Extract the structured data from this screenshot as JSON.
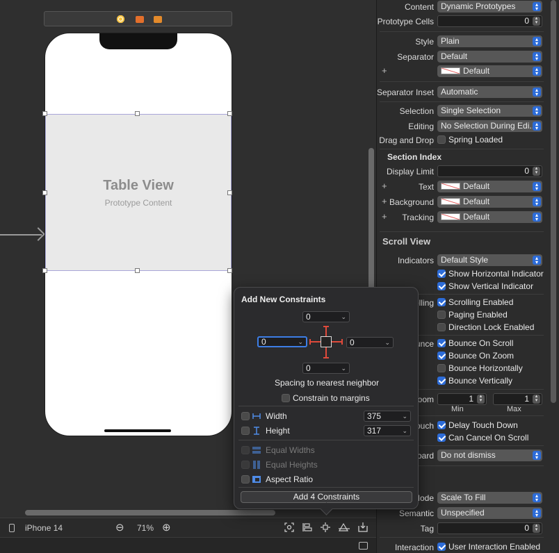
{
  "canvas": {
    "table_view_title": "Table View",
    "table_view_subtitle": "Prototype Content"
  },
  "bottombar": {
    "device": "iPhone 14",
    "zoom_out_glyph": "⊖",
    "zoom_level": "71%",
    "zoom_in_glyph": "⊕"
  },
  "inspector": {
    "content": {
      "label": "Content",
      "value": "Dynamic Prototypes"
    },
    "prototype_cells": {
      "label": "Prototype Cells",
      "value": "0"
    },
    "style": {
      "label": "Style",
      "value": "Plain"
    },
    "separator": {
      "label": "Separator",
      "value": "Default"
    },
    "separator_color": {
      "value": "Default"
    },
    "separator_inset": {
      "label": "Separator Inset",
      "value": "Automatic"
    },
    "selection": {
      "label": "Selection",
      "value": "Single Selection"
    },
    "editing": {
      "label": "Editing",
      "value": "No Selection During Edi..."
    },
    "drag_drop": {
      "label": "Drag and Drop",
      "checkbox": "Spring Loaded",
      "checked": false
    },
    "section_index": {
      "title": "Section Index",
      "display_limit": {
        "label": "Display Limit",
        "value": "0"
      },
      "text": {
        "label": "Text",
        "value": "Default"
      },
      "background": {
        "label": "Background",
        "value": "Default"
      },
      "tracking": {
        "label": "Tracking",
        "value": "Default"
      }
    },
    "scroll_view": {
      "title": "Scroll View",
      "indicators": {
        "label": "Indicators",
        "value": "Default Style"
      },
      "show_h": "Show Horizontal Indicator",
      "show_v": "Show Vertical Indicator",
      "scrolling_label": "Scrolling",
      "scrolling_enabled": "Scrolling Enabled",
      "paging_enabled": "Paging Enabled",
      "direction_lock": "Direction Lock Enabled",
      "bounce_label": "Bounce",
      "bounce_on_scroll": "Bounce On Scroll",
      "bounce_on_zoom": "Bounce On Zoom",
      "bounce_h": "Bounce Horizontally",
      "bounce_v": "Bounce Vertically",
      "zoom_label": "Zoom",
      "zoom_min": "1",
      "zoom_max": "1",
      "min_label": "Min",
      "max_label": "Max",
      "touch_label": "Touch",
      "delay_touch_down": "Delay Touch Down",
      "can_cancel": "Can Cancel On Scroll",
      "keyboard_label": "Keyboard",
      "keyboard_value": "Do not dismiss"
    },
    "view": {
      "mode_label": "Content Mode",
      "mode_value": "Scale To Fill",
      "semantic": {
        "label": "Semantic",
        "value": "Unspecified"
      },
      "tag": {
        "label": "Tag",
        "value": "0"
      },
      "interaction": {
        "label": "Interaction",
        "value": "User Interaction Enabled"
      }
    }
  },
  "popover": {
    "title": "Add New Constraints",
    "top": "0",
    "left": "0",
    "right": "0",
    "bottom": "0",
    "spacing_caption": "Spacing to nearest neighbor",
    "constrain_margins": "Constrain to margins",
    "width_label": "Width",
    "width_value": "375",
    "height_label": "Height",
    "height_value": "317",
    "equal_widths": "Equal Widths",
    "equal_heights": "Equal Heights",
    "aspect_ratio": "Aspect Ratio",
    "add_button": "Add 4 Constraints"
  },
  "colors": {
    "accent": "#2d6cd8",
    "strut": "#e04a3b",
    "selection_outline": "#a8a6d8"
  }
}
